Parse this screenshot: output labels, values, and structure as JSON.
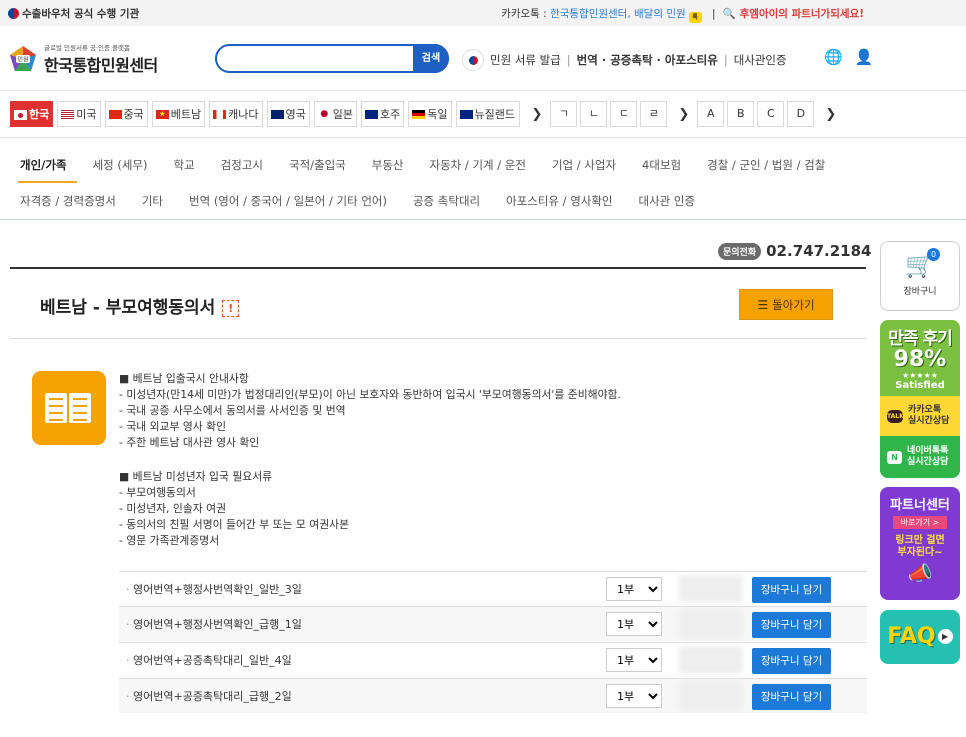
{
  "topbar": {
    "left": "수출바우처 공식 수행 기관",
    "kakao_prefix": "카카오톡 : ",
    "kakao_link": "한국통합민원센터, 배달의 민원",
    "kakao_badge": "톡",
    "partner_sep": "|",
    "partner_text": "후엠아이의 파트너가되세요!"
  },
  "header": {
    "logo_small": "글로벌 민원서류 공·인증 플랫폼",
    "logo_big": "한국통합민원센터",
    "search_button": "검색",
    "search_placeholder": "",
    "nav": [
      "민원 서류 발급",
      "번역 · 공증촉탁 · 아포스티유",
      "대사관인증"
    ],
    "sep": "|"
  },
  "countries": [
    {
      "label": "한국",
      "active": true,
      "flag": "kr"
    },
    {
      "label": "미국",
      "active": false,
      "flag": "us"
    },
    {
      "label": "중국",
      "active": false,
      "flag": "cn"
    },
    {
      "label": "베트남",
      "active": false,
      "flag": "vn"
    },
    {
      "label": "캐나다",
      "active": false,
      "flag": "ca"
    },
    {
      "label": "영국",
      "active": false,
      "flag": "gb"
    },
    {
      "label": "일본",
      "active": false,
      "flag": "jp"
    },
    {
      "label": "호주",
      "active": false,
      "flag": "au"
    },
    {
      "label": "독일",
      "active": false,
      "flag": "de"
    },
    {
      "label": "뉴질랜드",
      "active": false,
      "flag": "nz"
    }
  ],
  "letters_ko": [
    "ㄱ",
    "ㄴ",
    "ㄷ",
    "ㄹ"
  ],
  "letters_en": [
    "A",
    "B",
    "C",
    "D"
  ],
  "chevron": "❯",
  "menu_row1": [
    "개인/가족",
    "세정 (세무)",
    "학교",
    "검정고시",
    "국적/출입국",
    "부동산",
    "자동차 / 기계 / 운전",
    "기업 / 사업자",
    "4대보험",
    "경찰 / 군인 / 법원 / 검찰"
  ],
  "menu_row2": [
    "자격증 / 경력증명서",
    "기타",
    "번역 (영어 / 중국어 / 일본어 / 기타 언어)",
    "공증 촉탁대리",
    "아포스티유 / 영사확인",
    "대사관 인증"
  ],
  "phone": {
    "label": "문의전화",
    "number": "02.747.2184"
  },
  "title": "베트남 - 부모여행동의서",
  "title_mark": "!",
  "back_button": "돌아가기",
  "info_block1": [
    "■ 베트남 입출국시 안내사항",
    "- 미성년자(만14세 미만)가 법정대리인(부모)이 아닌 보호자와 동반하여 입국시 '부모여행동의서'를 준비해야함.",
    "- 국내 공증 사무소에서 동의서를 사서인증 및 번역",
    "- 국내 외교부 영사 확인",
    "- 주한 베트남 대사관 영사 확인"
  ],
  "info_block2": [
    "■ 베트남 미성년자 입국 필요서류",
    "- 부모여행동의서",
    "- 미성년자, 인솔자 여권",
    "- 동의서의 친필 서명이 들어간 부 또는 모 여권사본",
    "- 영문 가족관계증명서"
  ],
  "products": [
    {
      "name": "영어번역+행정사번역확인_일반_3일",
      "qty": "1부",
      "button": "장바구니 담기"
    },
    {
      "name": "영어번역+행정사번역확인_급행_1일",
      "qty": "1부",
      "button": "장바구니 담기"
    },
    {
      "name": "영어번역+공증촉탁대리_일반_4일",
      "qty": "1부",
      "button": "장바구니 담기"
    },
    {
      "name": "영어번역+공증촉탁대리_급행_2일",
      "qty": "1부",
      "button": "장바구니 담기"
    }
  ],
  "side": {
    "cart_count": "0",
    "cart_label": "장바구니",
    "review_title": "만족 후기",
    "review_percent": "98%",
    "review_stars": "★★★★★",
    "review_satisfied": "Satisfied",
    "kakao_icon": "TALK",
    "kakao_l1": "카카오톡",
    "kakao_l2": "실시간상담",
    "naver_icon": "N",
    "naver_l1": "네이버톡톡",
    "naver_l2": "실시간상담",
    "partner_title": "파트너센터",
    "partner_btn": "바로가기 >",
    "partner_l1": "링크만 걸면",
    "partner_l2": "부자된다~",
    "faq": "FAQ",
    "faq_play": "▶"
  }
}
